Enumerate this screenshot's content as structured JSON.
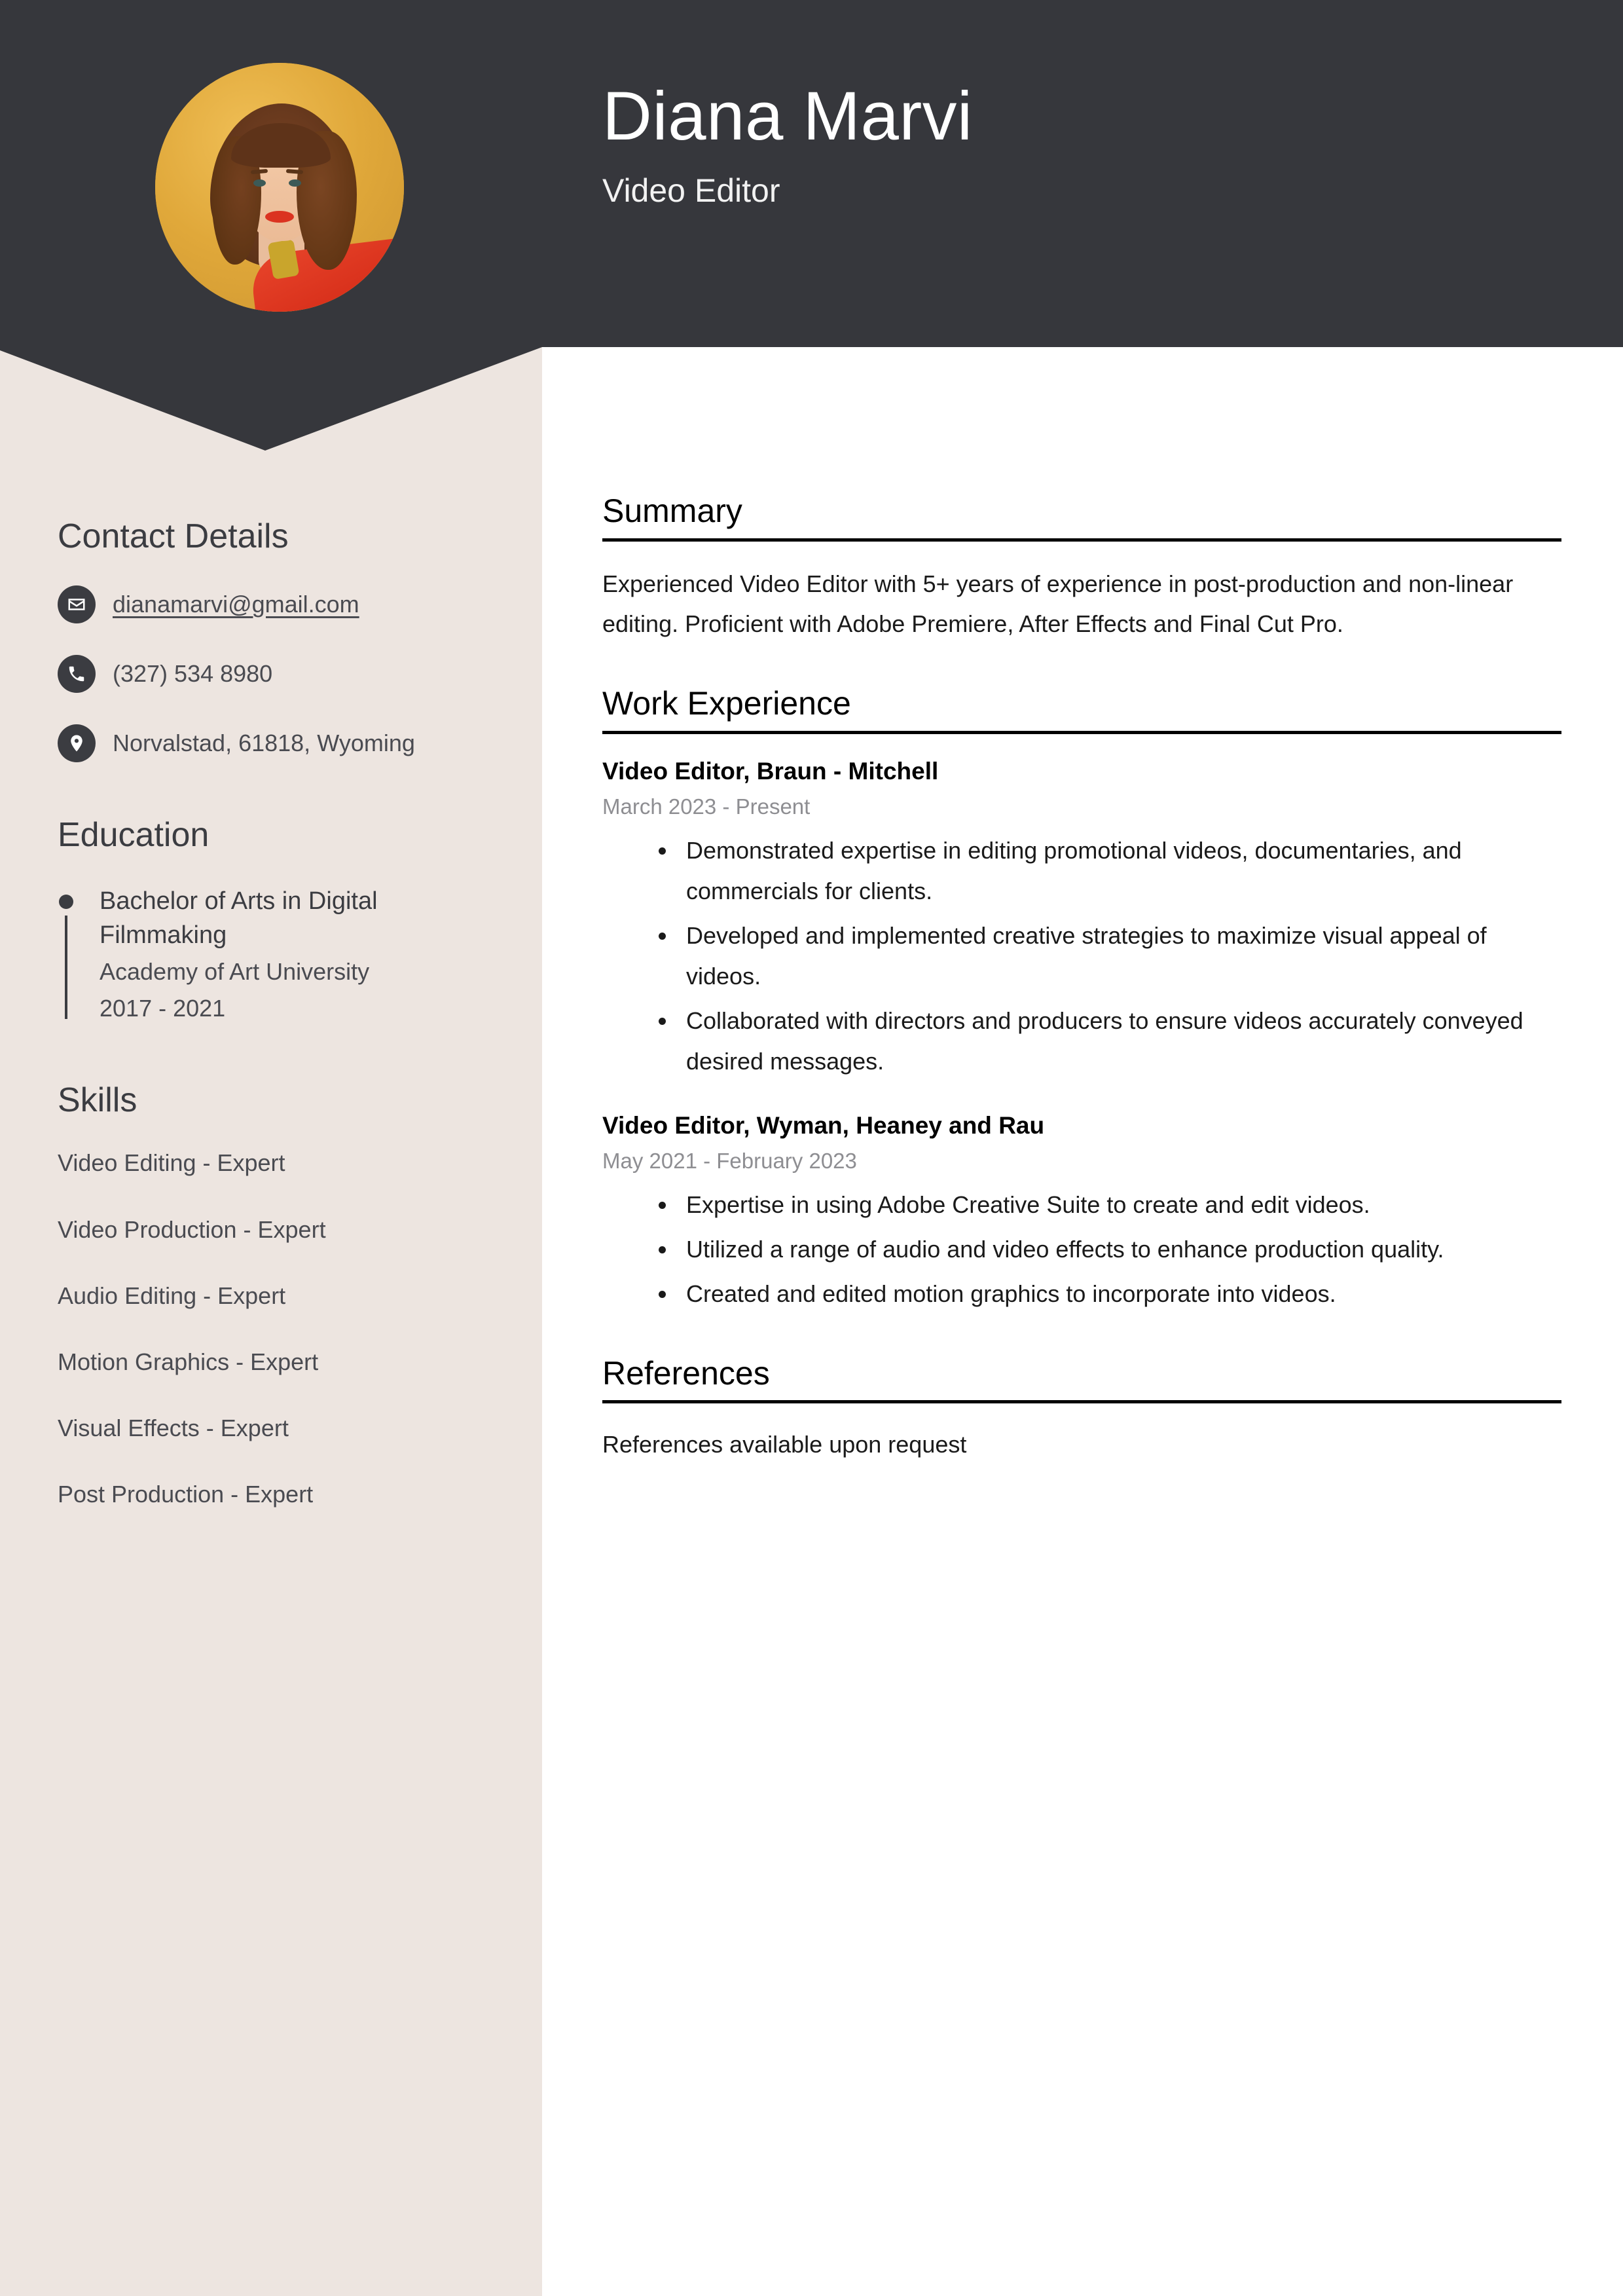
{
  "header": {
    "name": "Diana Marvi",
    "job_title": "Video Editor",
    "photo_alt": "portrait-photo",
    "background_color": "#36373C",
    "photo_background_color": "#E0A83A"
  },
  "sidebar": {
    "background_color": "#EDE5E0",
    "contact": {
      "heading": "Contact Details",
      "items": [
        {
          "icon": "envelope-icon",
          "value": "dianamarvi@gmail.com",
          "type": "email"
        },
        {
          "icon": "phone-icon",
          "value": "(327) 534 8980",
          "type": "phone"
        },
        {
          "icon": "map-pin-icon",
          "value": "Norvalstad, 61818, Wyoming",
          "type": "address"
        }
      ]
    },
    "education": {
      "heading": "Education",
      "items": [
        {
          "degree": "Bachelor of Arts in Digital Filmmaking",
          "school": "Academy of Art University",
          "dates": "2017 - 2021"
        }
      ]
    },
    "skills": {
      "heading": "Skills",
      "items": [
        "Video Editing - Expert",
        "Video Production - Expert",
        "Audio Editing - Expert",
        "Motion Graphics - Expert",
        "Visual Effects - Expert",
        "Post Production - Expert"
      ]
    }
  },
  "main": {
    "summary": {
      "heading": "Summary",
      "text": "Experienced Video Editor with 5+ years of experience in post-production and non-linear editing. Proficient with Adobe Premiere, After Effects and Final Cut Pro."
    },
    "work_experience": {
      "heading": "Work Experience",
      "jobs": [
        {
          "role": "Video Editor, Braun - Mitchell",
          "dates": "March 2023 - Present",
          "bullets": [
            "Demonstrated expertise in editing promotional videos, documentaries, and commercials for clients.",
            "Developed and implemented creative strategies to maximize visual appeal of videos.",
            "Collaborated with directors and producers to ensure videos accurately conveyed desired messages."
          ]
        },
        {
          "role": "Video Editor, Wyman, Heaney and Rau",
          "dates": "May 2021 - February 2023",
          "bullets": [
            "Expertise in using Adobe Creative Suite to create and edit videos.",
            "Utilized a range of audio and video effects to enhance production quality.",
            "Created and edited motion graphics to incorporate into videos."
          ]
        }
      ]
    },
    "references": {
      "heading": "References",
      "text": "References available upon request"
    }
  }
}
